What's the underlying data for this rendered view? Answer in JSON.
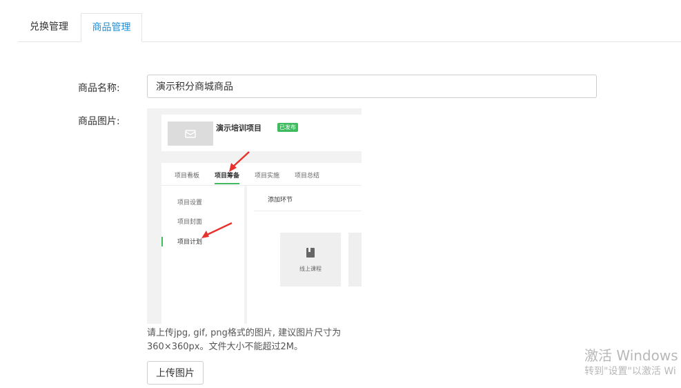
{
  "tabs": [
    {
      "label": "兑换管理",
      "active": false
    },
    {
      "label": "商品管理",
      "active": true
    }
  ],
  "form": {
    "name_label": "商品名称:",
    "name_value": "演示积分商城商品",
    "image_label": "商品图片:",
    "hint_line1": "请上传jpg, gif, png格式的图片, 建议图片尺寸为",
    "hint_line2": "360×360px。文件大小不能超过2M。",
    "upload_label": "上传图片"
  },
  "preview": {
    "project_title": "演示培训项目",
    "badge": "已发布",
    "tabs": [
      "项目看板",
      "项目筹备",
      "项目实施",
      "项目总结"
    ],
    "active_tab": "项目筹备",
    "side_items": [
      "项目设置",
      "项目封面",
      "项目计划"
    ],
    "main_title": "添加环节",
    "course_label": "线上课程"
  },
  "watermark": {
    "title": "激活 Windows",
    "subtitle": "转到\"设置\"以激活 Wi"
  },
  "colors": {
    "accent": "#1e8fd6",
    "green": "#3dbb5e",
    "arrow_red": "#e8322c"
  }
}
